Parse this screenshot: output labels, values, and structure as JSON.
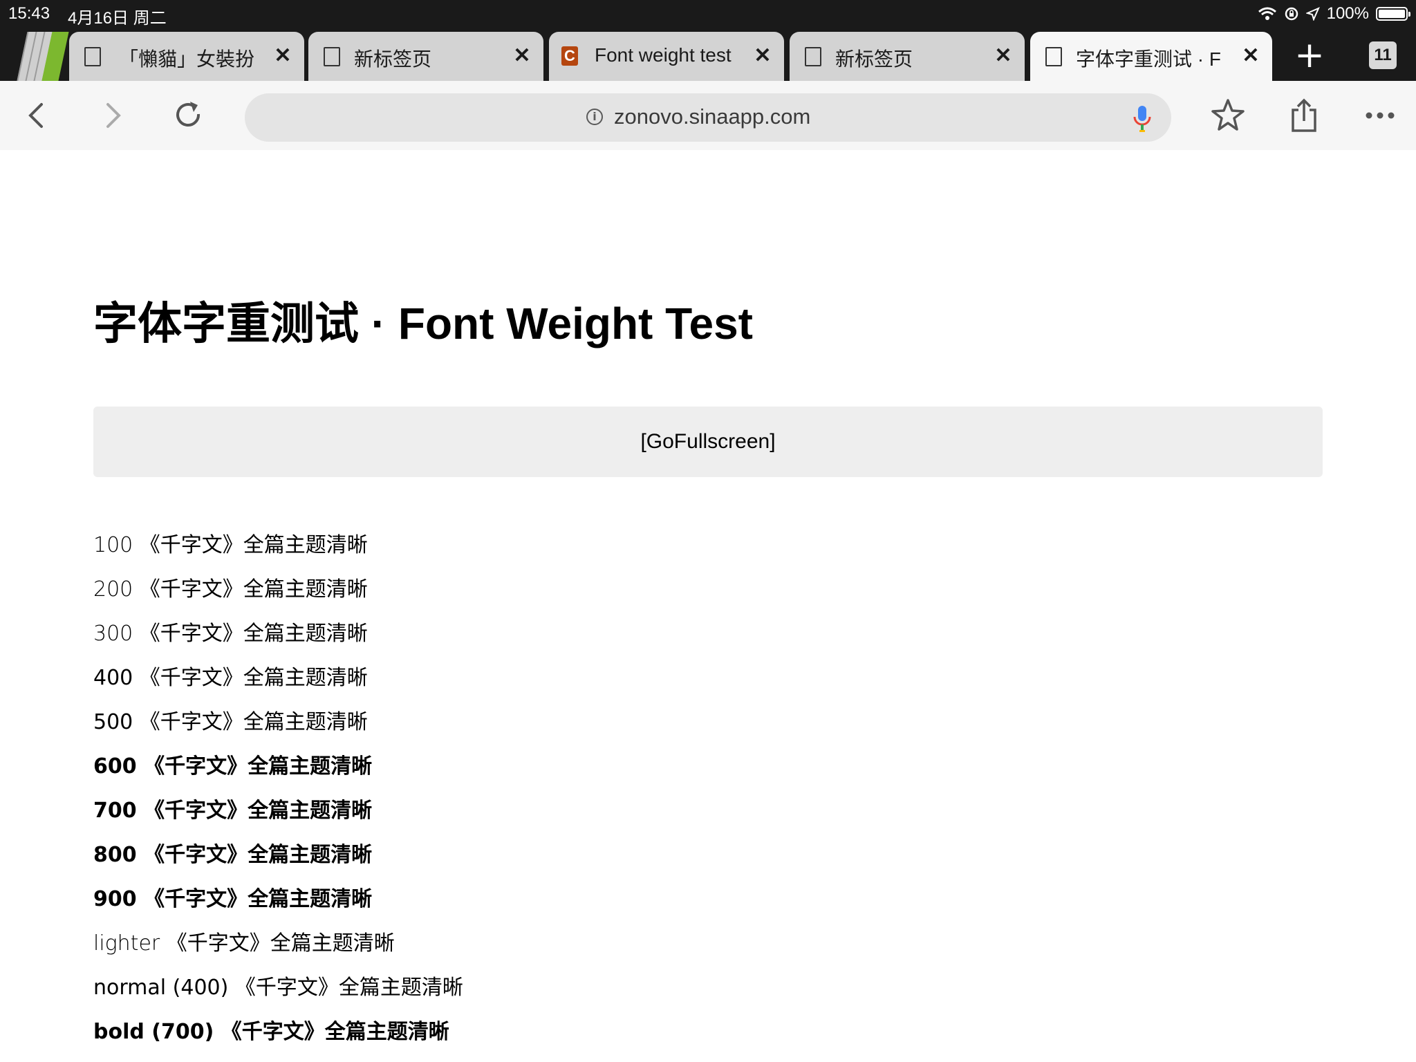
{
  "status_bar": {
    "time": "15:43",
    "date": "4月16日 周二",
    "battery": "100%",
    "icons": [
      "wifi-icon",
      "orientation-lock-icon",
      "location-arrow-icon",
      "battery-icon"
    ]
  },
  "tabs": [
    {
      "title": "「懶貓」女裝扮",
      "favicon": "page-icon",
      "active": false
    },
    {
      "title": "新标签页",
      "favicon": "page-icon",
      "active": false
    },
    {
      "title": "Font weight test",
      "favicon": "c-logo-icon",
      "active": false
    },
    {
      "title": "新标签页",
      "favicon": "page-icon",
      "active": false
    },
    {
      "title": "字体字重测试 · F",
      "favicon": "page-icon",
      "active": true
    }
  ],
  "tab_count": "11",
  "toolbar": {
    "url": "zonovo.sinaapp.com"
  },
  "page": {
    "title": "字体字重测试 · Font Weight Test",
    "fullscreen_button": "[GoFullscreen]",
    "samples": [
      {
        "label": "100 《千字文》全篇主题清晰",
        "weight": "100"
      },
      {
        "label": "200 《千字文》全篇主题清晰",
        "weight": "200"
      },
      {
        "label": "300 《千字文》全篇主题清晰",
        "weight": "300"
      },
      {
        "label": "400 《千字文》全篇主题清晰",
        "weight": "400"
      },
      {
        "label": "500 《千字文》全篇主题清晰",
        "weight": "500"
      },
      {
        "label": "600 《千字文》全篇主题清晰",
        "weight": "600"
      },
      {
        "label": "700 《千字文》全篇主题清晰",
        "weight": "700"
      },
      {
        "label": "800 《千字文》全篇主题清晰",
        "weight": "800"
      },
      {
        "label": "900 《千字文》全篇主题清晰",
        "weight": "900"
      },
      {
        "label": "lighter 《千字文》全篇主题清晰",
        "weight": "lighter"
      },
      {
        "label": "normal (400) 《千字文》全篇主题清晰",
        "weight": "normal"
      },
      {
        "label": "bold (700) 《千字文》全篇主题清晰",
        "weight": "bold"
      }
    ]
  }
}
